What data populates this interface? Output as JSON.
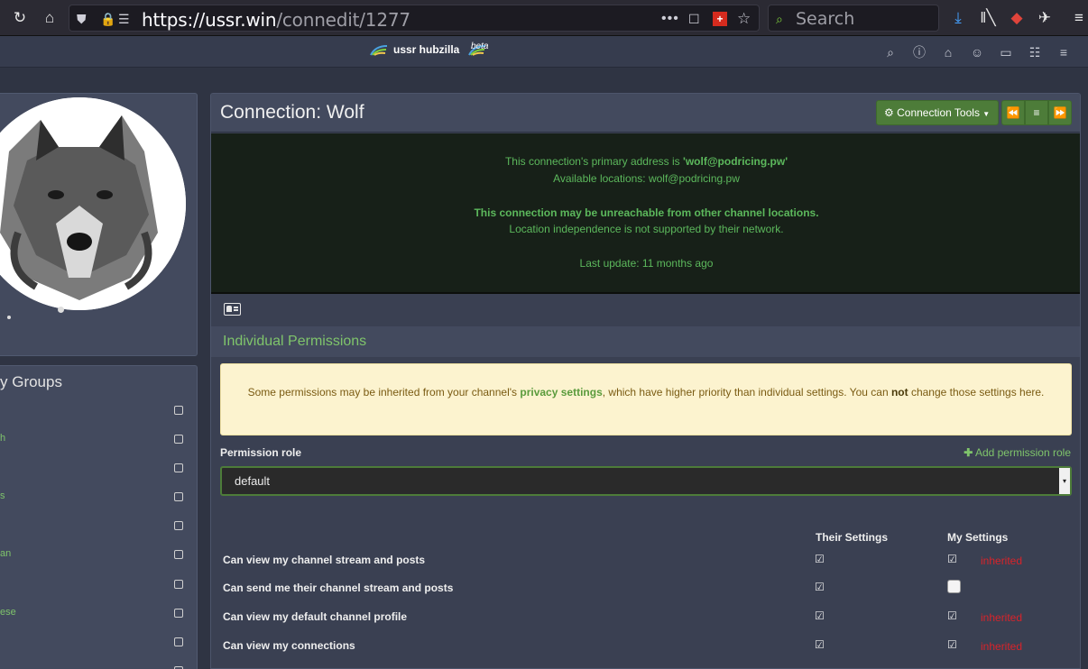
{
  "browser": {
    "url_host": "https://ussr.win",
    "url_path": "/connedit/1277",
    "search_placeholder": "Search"
  },
  "navbar": {
    "brand": "ussr hubzilla",
    "beta": "beta"
  },
  "groups": {
    "title": "y Groups",
    "items": [
      "",
      "h",
      "",
      "s",
      "",
      "an",
      "",
      "ese",
      "",
      ""
    ]
  },
  "connection": {
    "title": "Connection: Wolf",
    "tools_label": "Connection Tools",
    "info_primary_prefix": "This connection's primary address is ",
    "info_primary_address": "'wolf@podricing.pw'",
    "info_locations": "Available locations: wolf@podricing.pw",
    "info_unreachable": "This connection may be unreachable from other channel locations.",
    "info_independence": "Location independence is not supported by their network.",
    "info_last_update": "Last update: 11 months ago"
  },
  "permissions": {
    "title": "Individual Permissions",
    "warning_part1": "Some permissions may be inherited from your channel's ",
    "warning_link": "privacy settings",
    "warning_part2": ", which have higher priority than individual settings. You can ",
    "warning_not": "not",
    "warning_part3": " change those settings here.",
    "role_label": "Permission role",
    "add_role": "Add permission role",
    "role_value": "default",
    "col_theirs": "Their Settings",
    "col_mine": "My Settings",
    "rows": [
      {
        "label": "Can view my channel stream and posts",
        "their": true,
        "mine": true,
        "inherited": "inherited"
      },
      {
        "label": "Can send me their channel stream and posts",
        "their": true,
        "mine": false,
        "inherited": ""
      },
      {
        "label": "Can view my default channel profile",
        "their": true,
        "mine": true,
        "inherited": "inherited"
      },
      {
        "label": "Can view my connections",
        "their": true,
        "mine": true,
        "inherited": "inherited"
      }
    ]
  },
  "colors": {
    "accent_green": "#5cb85c",
    "button_green": "#4d7c39",
    "inherited_red": "#d9232a"
  }
}
